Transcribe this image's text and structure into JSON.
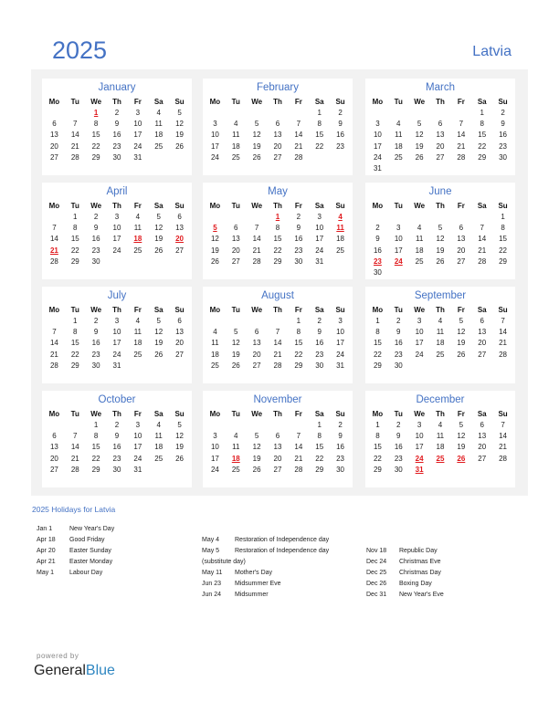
{
  "header": {
    "year": "2025",
    "country": "Latvia"
  },
  "weekdays": [
    "Mo",
    "Tu",
    "We",
    "Th",
    "Fr",
    "Sa",
    "Su"
  ],
  "months": [
    {
      "name": "January",
      "offset": 2,
      "days": 31,
      "holidays": [
        1
      ]
    },
    {
      "name": "February",
      "offset": 5,
      "days": 28,
      "holidays": []
    },
    {
      "name": "March",
      "offset": 5,
      "days": 31,
      "holidays": []
    },
    {
      "name": "April",
      "offset": 1,
      "days": 30,
      "holidays": [
        18,
        20,
        21
      ]
    },
    {
      "name": "May",
      "offset": 3,
      "days": 31,
      "holidays": [
        1,
        4,
        5,
        11
      ]
    },
    {
      "name": "June",
      "offset": 6,
      "days": 30,
      "holidays": [
        23,
        24
      ]
    },
    {
      "name": "July",
      "offset": 1,
      "days": 31,
      "holidays": []
    },
    {
      "name": "August",
      "offset": 4,
      "days": 31,
      "holidays": []
    },
    {
      "name": "September",
      "offset": 0,
      "days": 30,
      "holidays": []
    },
    {
      "name": "October",
      "offset": 2,
      "days": 31,
      "holidays": []
    },
    {
      "name": "November",
      "offset": 5,
      "days": 30,
      "holidays": [
        18
      ]
    },
    {
      "name": "December",
      "offset": 0,
      "days": 31,
      "holidays": [
        24,
        25,
        26,
        31
      ]
    }
  ],
  "holidays_title": "2025 Holidays for Latvia",
  "holiday_columns": [
    [
      {
        "date": "Jan 1",
        "name": "New Year's Day"
      },
      {
        "date": "Apr 18",
        "name": "Good Friday"
      },
      {
        "date": "Apr 20",
        "name": "Easter Sunday"
      },
      {
        "date": "Apr 21",
        "name": "Easter Monday"
      },
      {
        "date": "May 1",
        "name": "Labour Day"
      }
    ],
    [
      {
        "date": "May 4",
        "name": "Restoration of Independence day"
      },
      {
        "date": "May 5",
        "name": "Restoration of Independence day"
      },
      {
        "date": "",
        "name": "(substitute day)"
      },
      {
        "date": "May 11",
        "name": "Mother's Day"
      },
      {
        "date": "Jun 23",
        "name": "Midsummer Eve"
      },
      {
        "date": "Jun 24",
        "name": "Midsummer"
      }
    ],
    [
      {
        "date": "Nov 18",
        "name": "Republic Day"
      },
      {
        "date": "Dec 24",
        "name": "Christmas Eve"
      },
      {
        "date": "Dec 25",
        "name": "Christmas Day"
      },
      {
        "date": "Dec 26",
        "name": "Boxing Day"
      },
      {
        "date": "Dec 31",
        "name": "New Year's Eve"
      }
    ]
  ],
  "footer": {
    "powered_by": "powered by",
    "brand_general": "General",
    "brand_blue": "Blue"
  },
  "colors": {
    "accent": "#4472c4",
    "holiday": "#e0191d",
    "panel": "#f2f2f2"
  }
}
